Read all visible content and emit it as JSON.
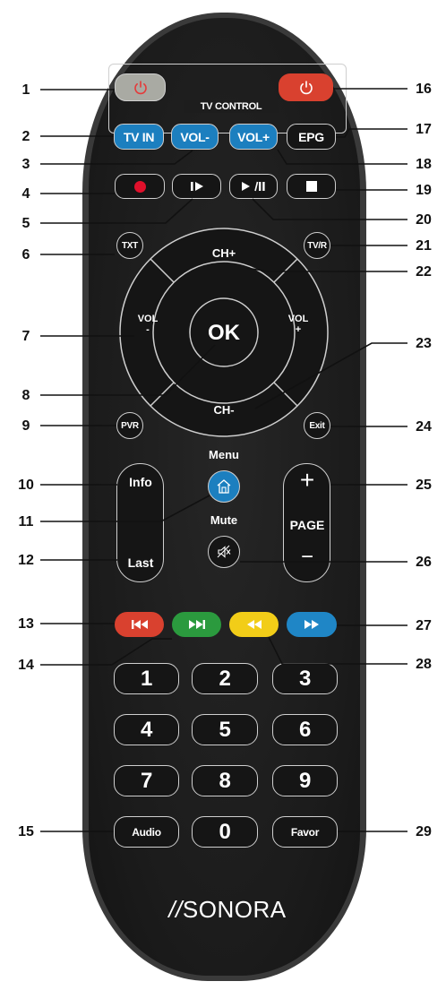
{
  "callouts_left": [
    "1",
    "2",
    "3",
    "4",
    "5",
    "6",
    "7",
    "8",
    "9",
    "10",
    "11",
    "12",
    "13",
    "14",
    "15"
  ],
  "callouts_right": [
    "16",
    "17",
    "18",
    "19",
    "20",
    "21",
    "22",
    "23",
    "24",
    "25",
    "26",
    "27",
    "28",
    "29"
  ],
  "tv_control": {
    "label": "TV CONTROL",
    "tv_in": "TV IN",
    "vol_minus": "VOL-",
    "vol_plus": "VOL+"
  },
  "top_row": {
    "epg": "EPG"
  },
  "side_round": {
    "txt": "TXT",
    "tvr": "TV/R",
    "pvr": "PVR",
    "exit": "Exit"
  },
  "dpad": {
    "up": "CH+",
    "down": "CH-",
    "left_top": "VOL",
    "left_bottom": "-",
    "right_top": "VOL",
    "right_bottom": "+",
    "ok": "OK"
  },
  "center": {
    "menu_label": "Menu",
    "mute_label": "Mute"
  },
  "info_last": {
    "info": "Info",
    "last": "Last"
  },
  "page": {
    "plus": "+",
    "label": "PAGE",
    "minus": "−"
  },
  "numbers": [
    "1",
    "2",
    "3",
    "4",
    "5",
    "6",
    "7",
    "8",
    "9",
    "0"
  ],
  "bottom_keys": {
    "audio": "Audio",
    "favor": "Favor"
  },
  "brand": {
    "slashes": "//",
    "name": "SONORA"
  },
  "colors": {
    "power_red": "#d9412f",
    "power_grey": "#a9aaa3",
    "blue": "#1c7fbf",
    "red": "#d9412f",
    "green": "#2b9a3e",
    "yellow": "#f2cd18",
    "light_blue": "#1f86c6",
    "record": "#e0102b"
  },
  "icons": [
    "power-icon",
    "record-icon",
    "step-forward-icon",
    "play-pause-icon",
    "stop-icon",
    "home-icon",
    "mute-icon",
    "skip-back-icon",
    "skip-forward-icon",
    "rewind-icon",
    "fast-forward-icon"
  ]
}
